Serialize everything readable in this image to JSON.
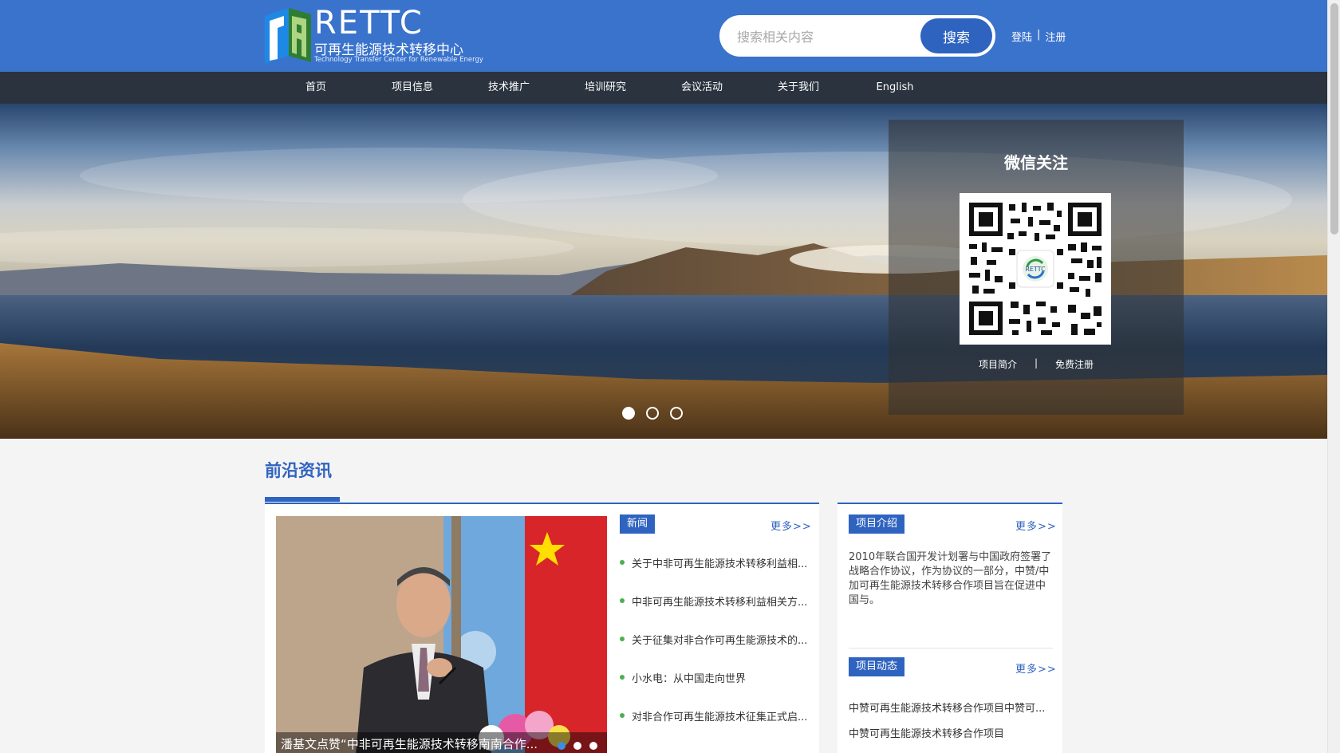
{
  "header": {
    "logo_text": "RETTC",
    "logo_cn": "可再生能源技术转移中心",
    "logo_en": "Technology Transfer Center for Renewable Energy",
    "search_placeholder": "搜索相关内容",
    "search_button": "搜索",
    "login": "登陆",
    "separator": "|",
    "register": "注册"
  },
  "nav": {
    "items": [
      "首页",
      "项目信息",
      "技术推广",
      "培训研究",
      "会议活动",
      "关于我们",
      "English"
    ]
  },
  "banner": {
    "wechat_title": "微信关注",
    "link_intro": "项目简介",
    "link_sep": "|",
    "link_register": "免费注册",
    "qr_logo": "RETTC",
    "slide_count": 3,
    "active_slide": 1
  },
  "section": {
    "title": "前沿资讯"
  },
  "feature": {
    "caption": "潘基文点赞“中非可再生能源技术转移南南合作..."
  },
  "news": {
    "tag": "新闻",
    "more": "更多>>",
    "items": [
      "关于中非可再生能源技术转移利益相...",
      "中非可再生能源技术转移利益相关方...",
      "关于征集对非合作可再生能源技术的...",
      "小水电：从中国走向世界",
      "对非合作可再生能源技术征集正式启..."
    ]
  },
  "project_intro": {
    "tag": "项目介绍",
    "more": "更多>>",
    "text": "2010年联合国开发计划署与中国政府签署了战略合作协议，作为协议的一部分，中赞/中加可再生能源技术转移合作项目旨在促进中国与。"
  },
  "project_news": {
    "tag": "项目动态",
    "more": "更多>>",
    "items": [
      "中赞可再生能源技术转移合作项目中赞可...",
      "中赞可再生能源技术转移合作项目"
    ]
  },
  "colors": {
    "header_blue": "#3a73cc",
    "accent_blue": "#2f63c0",
    "nav_dark": "#2a333e"
  }
}
